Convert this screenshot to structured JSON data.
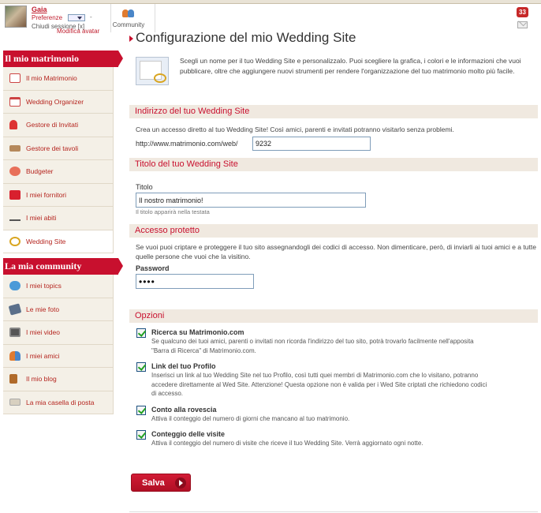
{
  "topbar": {
    "user_name": "Gaia",
    "preferences_label": "Preferenze",
    "dash": "-",
    "logout_label": "Chiudi sessione [x]",
    "edit_avatar_label": "Modifica avatar",
    "community_label": "Community",
    "notification_count": "33"
  },
  "sidebar": {
    "section1_title": "Il mio matrimonio",
    "section1_items": [
      {
        "label": "Il mio Matrimonio",
        "icon": "calendar-heart-icon"
      },
      {
        "label": "Wedding Organizer",
        "icon": "organizer-icon"
      },
      {
        "label": "Gestore di Invitati",
        "icon": "guests-icon"
      },
      {
        "label": "Gestore dei tavoli",
        "icon": "tables-icon"
      },
      {
        "label": "Budgeter",
        "icon": "budget-icon"
      },
      {
        "label": "I miei fornitori",
        "icon": "heart-icon"
      },
      {
        "label": "I miei abiti",
        "icon": "hanger-icon"
      },
      {
        "label": "Wedding Site",
        "icon": "rings-icon"
      }
    ],
    "section2_title": "La mia community",
    "section2_items": [
      {
        "label": "I miei topics",
        "icon": "speech-bubbles-icon"
      },
      {
        "label": "Le mie foto",
        "icon": "photo-icon"
      },
      {
        "label": "I miei video",
        "icon": "video-icon"
      },
      {
        "label": "I miei amici",
        "icon": "friends-icon"
      },
      {
        "label": "Il mio blog",
        "icon": "blog-icon"
      },
      {
        "label": "La mia casella di posta",
        "icon": "mail-icon"
      }
    ]
  },
  "main": {
    "title": "Configurazione del mio Wedding Site",
    "intro": "Scegli un nome per il tuo Wedding Site e personalizzalo. Puoi scegliere la grafica, i colori e le informazioni che vuoi pubblicare, oltre che aggiungere nuovi strumenti per rendere l'organizzazione del tuo matrimonio molto più facile.",
    "address": {
      "heading": "Indirizzo del tuo Wedding Site",
      "desc": "Crea un accesso diretto al tuo Wedding Site! Così amici, parenti e invitati potranno visitarlo senza problemi.",
      "url_prefix": "http://www.matrimonio.com/web/",
      "url_value": "9232"
    },
    "title_section": {
      "heading": "Titolo del tuo Wedding Site",
      "label": "Titolo",
      "value": "Il nostro matrimonio!",
      "help": "Il titolo apparirà nella testata"
    },
    "protected": {
      "heading": "Accesso protetto",
      "desc": "Se vuoi puoi criptare e proteggere il tuo sito assegnandogli dei codici di accesso. Non dimenticare, però, di inviarli ai tuoi amici e a tutte quelle persone che vuoi che la visitino.",
      "password_label": "Password",
      "password_value": "abcd"
    },
    "options": {
      "heading": "Opzioni",
      "items": [
        {
          "title": "Ricerca su Matrimonio.com",
          "desc": "Se qualcuno dei tuoi amici, parenti o invitati non ricorda l'indirizzo del tuo sito, potrà trovarlo facilmente nell'apposita \"Barra di Ricerca\" di Matrimonio.com.",
          "checked": true
        },
        {
          "title": "Link del tuo Profilo",
          "desc": "Inserisci un link al tuo Wedding Site nel tuo Profilo, così tutti quei membri di Matrimonio.com che lo visitano, potranno accedere direttamente al Wed Site. Attenzione! Questa opzione non è valida per i Wed Site criptati che richiedono codici di accesso.",
          "checked": true
        },
        {
          "title": "Conto alla rovescia",
          "desc": "Attiva il conteggio del numero di giorni che mancano al tuo matrimonio.",
          "checked": true
        },
        {
          "title": "Conteggio delle visite",
          "desc": "Attiva il conteggio del numero di visite che riceve il tuo Wedding Site. Verrà aggiornato ogni notte.",
          "checked": true
        }
      ]
    },
    "save_label": "Salva"
  },
  "colors": {
    "accent": "#c8102e",
    "section_bar_bg": "#f0e9e0",
    "sidebar_bg": "#f4f0e7"
  }
}
